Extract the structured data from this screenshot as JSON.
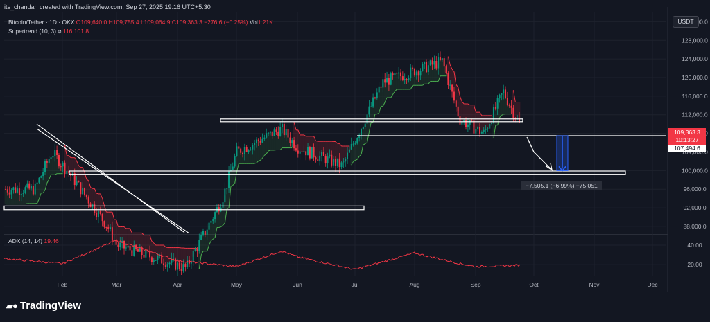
{
  "header": {
    "attribution": "its_chandan created with TradingView.com, Sep 27, 2025 19:16 UTC+5:30"
  },
  "legend": {
    "symbol": "Bitcoin/Tether · 1D · OKX",
    "open": "O109,640.0",
    "high": "H109,755.4",
    "low": "L109,064.9",
    "close": "C109,363.3",
    "change": "−276.6 (−0.25%)",
    "volume_label": "Vol",
    "volume": "1.21K",
    "supertrend_label": "Supertrend (10, 3)",
    "supertrend_symbol": "⌀",
    "supertrend_value": "116,101.8"
  },
  "indicator": {
    "label": "ADX (14, 14)",
    "value": "19.46"
  },
  "currency_button": "USDT",
  "price_label": {
    "price": "109,363.3",
    "countdown": "10:13:27"
  },
  "level_label": "107,494.6",
  "measure_label": "−7,505.1 (−6.99%) −75,051",
  "footer": {
    "brand": "TradingView",
    "logo_icon": "tradingview-logo-icon"
  },
  "colors": {
    "background": "#131722",
    "up": "#089981",
    "down": "#f23645",
    "supertrend_up": "#4caf50",
    "supertrend_down": "#f23645",
    "adx_line": "#f23645",
    "box_stroke": "#ffffff",
    "measure": "#2962ff"
  },
  "chart_data": {
    "type": "candlestick",
    "symbol": "Bitcoin/Tether",
    "interval": "1D",
    "y_axis": {
      "ticks": [
        "132,000.0",
        "128,000.0",
        "124,000.0",
        "120,000.0",
        "116,000.0",
        "112,000.0",
        "108,000.0",
        "104,000.0",
        "100,000.0",
        "96,000.0",
        "92,000.0",
        "88,000.0"
      ],
      "tick_values": [
        132000,
        128000,
        124000,
        120000,
        116000,
        112000,
        108000,
        104000,
        100000,
        96000,
        92000,
        88000
      ],
      "ylim": [
        86500,
        134000
      ]
    },
    "x_axis": {
      "labels": [
        "Feb",
        "Mar",
        "Apr",
        "May",
        "Jun",
        "Jul",
        "Aug",
        "Sep",
        "Oct",
        "Nov",
        "Dec"
      ]
    },
    "adx_axis": {
      "ticks": [
        "40.00",
        "20.00"
      ],
      "tick_values": [
        40,
        20
      ],
      "ylim": [
        8,
        50
      ]
    },
    "price_anchors": [
      {
        "month": "Jan (mid)",
        "price": 96000
      },
      {
        "month": "Jan (late)",
        "price": 104000
      },
      {
        "month": "Feb (early)",
        "price": 99000
      },
      {
        "month": "Feb (late)",
        "price": 88000
      },
      {
        "month": "Mar",
        "price": 84000
      },
      {
        "month": "Apr (early)",
        "price": 79000
      },
      {
        "month": "Apr (late)",
        "price": 94000
      },
      {
        "month": "May",
        "price": 104000
      },
      {
        "month": "May (late)",
        "price": 109000
      },
      {
        "month": "Jun",
        "price": 105000
      },
      {
        "month": "Jun (late)",
        "price": 101000
      },
      {
        "month": "Jul (mid)",
        "price": 119000
      },
      {
        "month": "Aug (mid)",
        "price": 123500
      },
      {
        "month": "Aug (late)",
        "price": 111000
      },
      {
        "month": "Sep (early)",
        "price": 108000
      },
      {
        "month": "Sep (mid)",
        "price": 117000
      },
      {
        "month": "Sep (late)",
        "price": 109363
      }
    ],
    "support_resistance_zones": [
      {
        "low": 110600,
        "high": 111100
      },
      {
        "low": 99200,
        "high": 99900
      },
      {
        "low": 91600,
        "high": 92400
      }
    ],
    "horizontal_level": 107494.6,
    "measure": {
      "from": 107494.6,
      "to": 99989.5,
      "change": -7505.1,
      "percent": -6.99
    },
    "adx_anchors": [
      {
        "month": "Jan",
        "value": 26
      },
      {
        "month": "Feb",
        "value": 21
      },
      {
        "month": "Mar",
        "value": 45
      },
      {
        "month": "Apr",
        "value": 24
      },
      {
        "month": "May",
        "value": 18
      },
      {
        "month": "May (late)",
        "value": 34
      },
      {
        "month": "Jun",
        "value": 28
      },
      {
        "month": "Jul",
        "value": 15
      },
      {
        "month": "Aug",
        "value": 32
      },
      {
        "month": "Aug (late)",
        "value": 21
      },
      {
        "month": "Sep",
        "value": 18
      },
      {
        "month": "Sep (late)",
        "value": 19.46
      }
    ]
  }
}
